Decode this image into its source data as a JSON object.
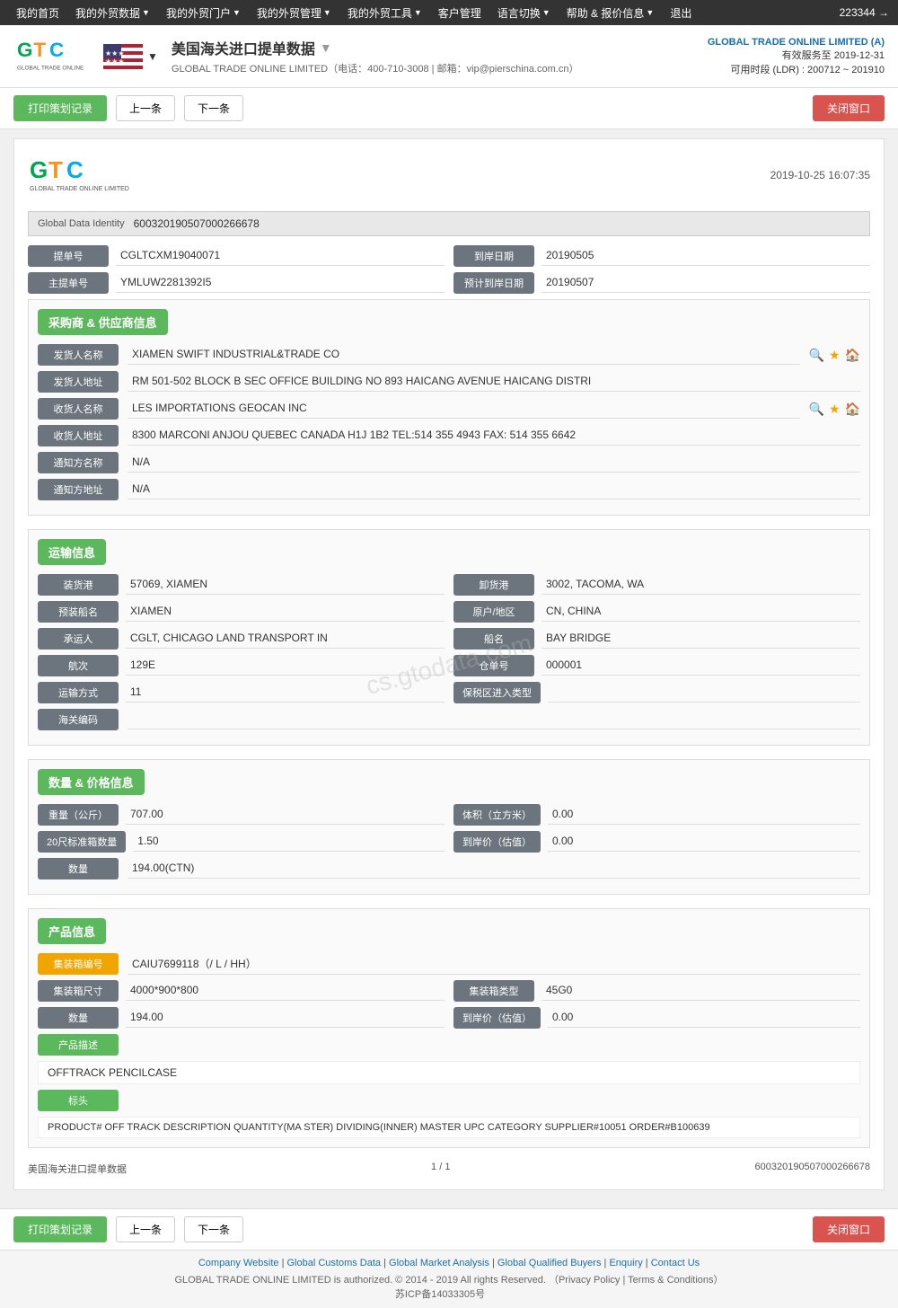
{
  "topnav": {
    "items": [
      {
        "label": "我的首页",
        "id": "home"
      },
      {
        "label": "我的外贸数据",
        "id": "trade-data"
      },
      {
        "label": "我的外贸门户",
        "id": "trade-portal"
      },
      {
        "label": "我的外贸管理",
        "id": "trade-mgmt"
      },
      {
        "label": "我的外贸工具",
        "id": "trade-tools"
      },
      {
        "label": "客户管理",
        "id": "customer"
      },
      {
        "label": "语言切换",
        "id": "language"
      },
      {
        "label": "帮助 & 报价信息",
        "id": "help"
      },
      {
        "label": "退出",
        "id": "logout"
      }
    ],
    "user_count": "223344 →"
  },
  "header": {
    "title": "美国海关进口提单数据",
    "subtitle": "GLOBAL TRADE ONLINE LIMITED（电话：400-710-3008 | 邮箱：vip@pierschina.com.cn）",
    "company": "GLOBAL TRADE ONLINE LIMITED (A)",
    "valid_until": "有效服务至 2019-12-31",
    "available_time": "可用时段 (LDR) : 200712 ~ 201910"
  },
  "toolbar": {
    "print_label": "打印策划记录",
    "prev_label": "上一条",
    "next_label": "下一条",
    "close_label": "关闭窗口"
  },
  "record": {
    "timestamp": "2019-10-25 16:07:35",
    "global_data_identity_label": "Global Data Identity",
    "global_data_identity_value": "600320190507000266678",
    "fields": {
      "bill_no_label": "提单号",
      "bill_no_value": "CGLTCXM19040071",
      "arrival_date_label": "到岸日期",
      "arrival_date_value": "20190505",
      "master_bill_label": "主提单号",
      "master_bill_value": "YMLUW2281392I5",
      "planned_date_label": "预计到岸日期",
      "planned_date_value": "20190507"
    }
  },
  "sections": {
    "supplier": {
      "title": "采购商 & 供应商信息",
      "shipper_name_label": "发货人名称",
      "shipper_name_value": "XIAMEN SWIFT INDUSTRIAL&TRADE CO",
      "shipper_addr_label": "发货人地址",
      "shipper_addr_value": "RM 501-502 BLOCK B SEC OFFICE BUILDING NO 893 HAICANG AVENUE HAICANG DISTRI",
      "consignee_name_label": "收货人名称",
      "consignee_name_value": "LES IMPORTATIONS GEOCAN INC",
      "consignee_addr_label": "收货人地址",
      "consignee_addr_value": "8300 MARCONI ANJOU QUEBEC CANADA H1J 1B2 TEL:514 355 4943 FAX: 514 355 6642",
      "notify_name_label": "通知方名称",
      "notify_name_value": "N/A",
      "notify_addr_label": "通知方地址",
      "notify_addr_value": "N/A"
    },
    "transport": {
      "title": "运输信息",
      "loading_port_label": "装货港",
      "loading_port_value": "57069, XIAMEN",
      "unloading_port_label": "卸货港",
      "unloading_port_value": "3002, TACOMA, WA",
      "pre_vessel_label": "预装船名",
      "pre_vessel_value": "XIAMEN",
      "country_label": "原户/地区",
      "country_value": "CN, CHINA",
      "carrier_label": "承运人",
      "carrier_value": "CGLT, CHICAGO LAND TRANSPORT IN",
      "vessel_label": "船名",
      "vessel_value": "BAY BRIDGE",
      "voyage_label": "航次",
      "voyage_value": "129E",
      "warehouse_label": "仓单号",
      "warehouse_value": "000001",
      "transport_mode_label": "运输方式",
      "transport_mode_value": "11",
      "customs_type_label": "保税区进入类型",
      "customs_type_value": "",
      "customs_code_label": "海关编码",
      "customs_code_value": ""
    },
    "quantity": {
      "title": "数量 & 价格信息",
      "weight_label": "重量（公斤）",
      "weight_value": "707.00",
      "volume_label": "体积（立方米）",
      "volume_value": "0.00",
      "container20_label": "20尺标准箱数量",
      "container20_value": "1.50",
      "unit_price_label": "到岸价（估值）",
      "unit_price_value": "0.00",
      "quantity_label": "数量",
      "quantity_value": "194.00(CTN)"
    },
    "product": {
      "title": "产品信息",
      "container_no_label": "集装箱编号",
      "container_no_value": "CAIU7699118（/ L / HH）",
      "container_size_label": "集装箱尺寸",
      "container_size_value": "4000*900*800",
      "container_type_label": "集装箱类型",
      "container_type_value": "45G0",
      "quantity_label": "数量",
      "quantity_value": "194.00",
      "unit_price_label": "到岸价（估值）",
      "unit_price_value": "0.00",
      "desc_label": "产品描述",
      "desc_value": "OFFTRACK PENCILCASE",
      "marks_label": "标头",
      "marks_value": "PRODUCT# OFF TRACK DESCRIPTION QUANTITY(MA STER) DIVIDING(INNER) MASTER UPC CATEGORY SUPPLIER#10051 ORDER#B100639"
    }
  },
  "pagination": {
    "current": "1 / 1",
    "record_id": "600320190507000266678",
    "source": "美国海关进口提单数据"
  },
  "footer": {
    "links": [
      "Company Website",
      "Global Customs Data",
      "Global Market Analysis",
      "Global Qualified Buyers",
      "Enquiry",
      "Contact Us"
    ],
    "copyright": "GLOBAL TRADE ONLINE LIMITED is authorized. © 2014 - 2019 All rights Reserved. （Privacy Policy | Terms & Conditions）",
    "icp": "苏ICP备14033305号"
  },
  "watermark": "cs.gtodata.com"
}
